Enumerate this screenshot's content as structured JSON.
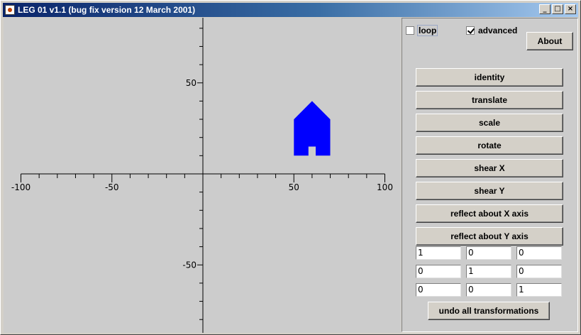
{
  "window": {
    "title": "LEG 01 v1.1 (bug fix version 12 March 2001)",
    "controls": {
      "minimize": "_",
      "maximize": "□",
      "close": "×"
    }
  },
  "plot": {
    "x_ticks": [
      "-100",
      "-50",
      "50",
      "100"
    ],
    "y_ticks": [
      "50",
      "-50"
    ],
    "x_range": [
      -100,
      100
    ],
    "y_range": [
      -100,
      100
    ],
    "shape_color": "#0000ff",
    "house_outline": [
      [
        50,
        30
      ],
      [
        60,
        40
      ],
      [
        70,
        30
      ],
      [
        70,
        10
      ],
      [
        62,
        10
      ],
      [
        62,
        15
      ],
      [
        58,
        15
      ],
      [
        58,
        10
      ],
      [
        50,
        10
      ]
    ]
  },
  "options": {
    "loop": {
      "label": "loop",
      "checked": false
    },
    "advanced": {
      "label": "advanced",
      "checked": true
    }
  },
  "buttons": {
    "about": "About",
    "identity": "identity",
    "translate": "translate",
    "scale": "scale",
    "rotate": "rotate",
    "shear_x": "shear X",
    "shear_y": "shear Y",
    "reflect_x": "reflect about X axis",
    "reflect_y": "reflect about Y axis",
    "undo": "undo all transformations"
  },
  "matrix": [
    [
      "1",
      "0",
      "0"
    ],
    [
      "0",
      "1",
      "0"
    ],
    [
      "0",
      "0",
      "1"
    ]
  ]
}
